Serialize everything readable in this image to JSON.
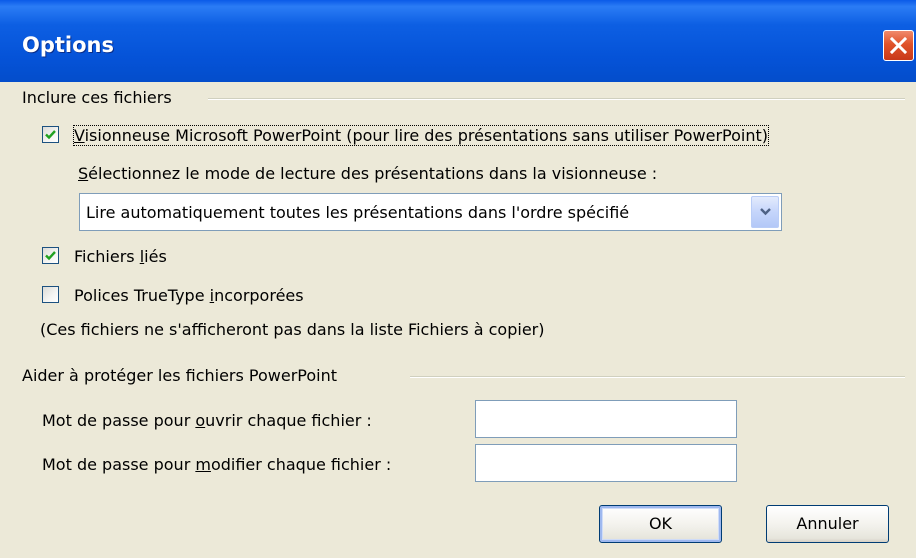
{
  "window": {
    "title": "Options",
    "close_icon": "close-x-icon"
  },
  "include_group": {
    "label": "Inclure ces fichiers",
    "viewer_checkbox": {
      "checked": true,
      "label_mnemonic": "V",
      "label_rest": "isionneuse Microsoft PowerPoint (pour lire des présentations sans utiliser PowerPoint)"
    },
    "mode_prompt": {
      "mnemonic": "S",
      "rest": "électionnez le mode de lecture des présentations dans la visionneuse :"
    },
    "mode_select": {
      "value": "Lire automatiquement toutes les présentations dans l'ordre spécifié"
    },
    "linked_checkbox": {
      "checked": true,
      "label_pre": "Fichiers ",
      "label_mnemonic": "l",
      "label_post": "iés"
    },
    "truetype_checkbox": {
      "checked": false,
      "label_pre": "Polices TrueType ",
      "label_mnemonic": "i",
      "label_post": "ncorporées"
    },
    "note": "(Ces fichiers ne s'afficheront pas dans la liste Fichiers à copier)"
  },
  "protect_group": {
    "label": "Aider à protéger les fichiers PowerPoint",
    "open_password": {
      "label_pre": "Mot de passe pour ",
      "label_mnemonic": "o",
      "label_post": "uvrir chaque fichier :",
      "value": ""
    },
    "modify_password": {
      "label_pre": "Mot de passe pour ",
      "label_mnemonic": "m",
      "label_post": "odifier chaque fichier :",
      "value": ""
    }
  },
  "buttons": {
    "ok": "OK",
    "cancel": "Annuler"
  },
  "colors": {
    "title_bar": "#0553d8",
    "dialog_background": "#ece9d8",
    "close_button": "#e0532a",
    "check_mark": "#21a121",
    "control_border": "#7f9db9"
  }
}
